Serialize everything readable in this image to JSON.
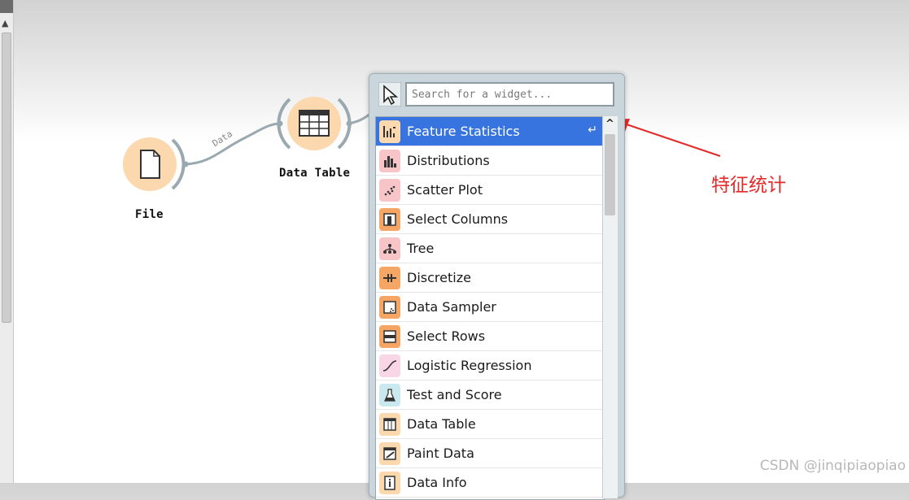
{
  "canvas": {
    "nodes": [
      {
        "label": "File",
        "icon": "document-icon",
        "color": "#fbd8ad"
      },
      {
        "label": "Data Table",
        "icon": "table-icon",
        "color": "#fbd8ad"
      }
    ],
    "link_label": "Data"
  },
  "widget_menu": {
    "search_placeholder": "Search for a widget...",
    "selected_index": 0,
    "items": [
      {
        "label": "Feature Statistics",
        "icon": "feature-statistics-icon",
        "tile_color": "#fbd8ad"
      },
      {
        "label": "Distributions",
        "icon": "distributions-icon",
        "tile_color": "#f7c5c8"
      },
      {
        "label": "Scatter Plot",
        "icon": "scatter-plot-icon",
        "tile_color": "#f7c5c8"
      },
      {
        "label": "Select Columns",
        "icon": "select-columns-icon",
        "tile_color": "#f5a564"
      },
      {
        "label": "Tree",
        "icon": "tree-icon",
        "tile_color": "#f7c5c8"
      },
      {
        "label": "Discretize",
        "icon": "discretize-icon",
        "tile_color": "#f5a564"
      },
      {
        "label": "Data Sampler",
        "icon": "data-sampler-icon",
        "tile_color": "#f5a564"
      },
      {
        "label": "Select Rows",
        "icon": "select-rows-icon",
        "tile_color": "#f5a564"
      },
      {
        "label": "Logistic Regression",
        "icon": "logistic-regression-icon",
        "tile_color": "#f8d6e6"
      },
      {
        "label": "Test and Score",
        "icon": "test-and-score-icon",
        "tile_color": "#c9e9ee"
      },
      {
        "label": "Data Table",
        "icon": "data-table-icon",
        "tile_color": "#fbd8ad"
      },
      {
        "label": "Paint Data",
        "icon": "paint-data-icon",
        "tile_color": "#fbd8ad"
      },
      {
        "label": "Data Info",
        "icon": "data-info-icon",
        "tile_color": "#fbd8ad"
      }
    ]
  },
  "annotation": {
    "text": "特征统计",
    "color": "#e52a2a"
  },
  "watermark": "CSDN @jinqipiaopiao"
}
